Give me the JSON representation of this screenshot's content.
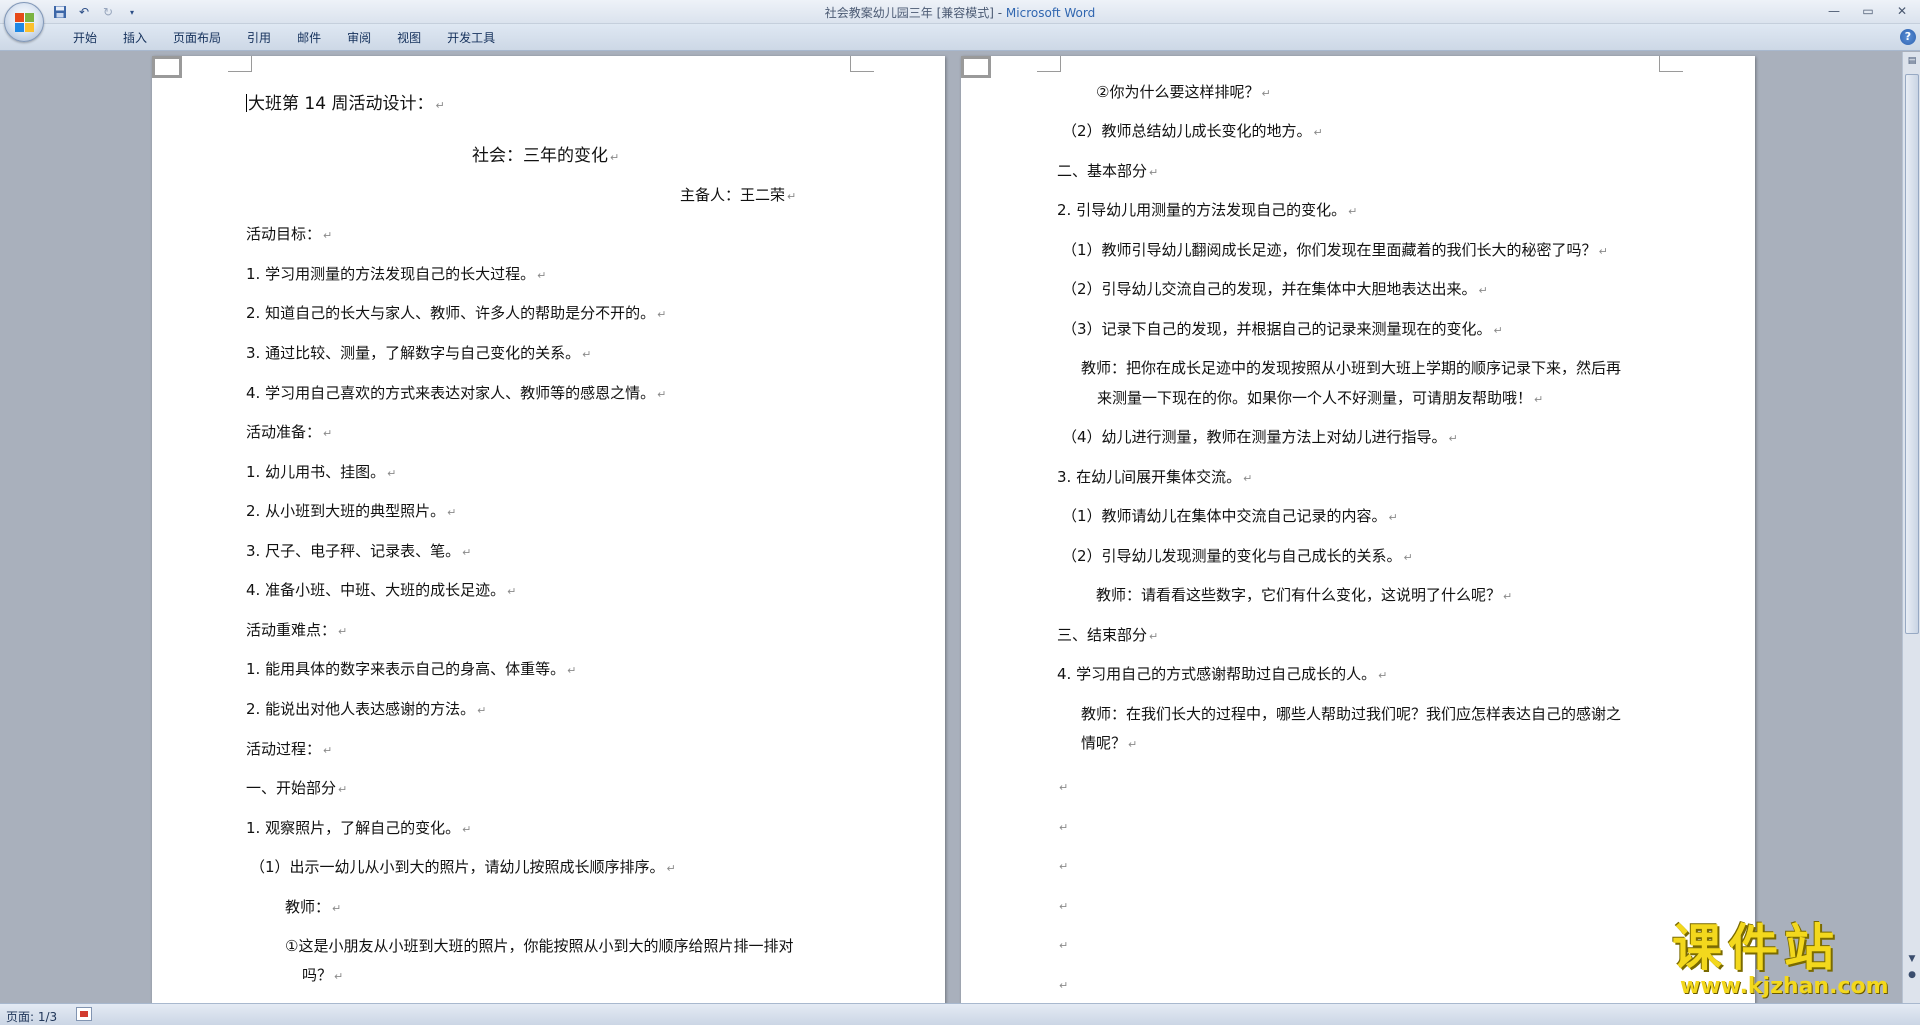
{
  "window": {
    "title_doc": "社会教案幼儿园三年 [兼容模式] - ",
    "title_app": "Microsoft Word"
  },
  "ribbon": {
    "tabs": [
      "开始",
      "插入",
      "页面布局",
      "引用",
      "邮件",
      "审阅",
      "视图",
      "开发工具"
    ]
  },
  "status": {
    "page": "页面: 1/3"
  },
  "watermark": {
    "cn": "课件站",
    "url": "www.kjzhan.com"
  },
  "left_page": {
    "title": "大班第 14 周活动设计：",
    "subtitle": "社会：三年的变化",
    "author": "主备人：王二荣",
    "lines": [
      "活动目标：",
      "1.   学习用测量的方法发现自己的长大过程。",
      "2.   知道自己的长大与家人、教师、许多人的帮助是分不开的。",
      "3.   通过比较、测量，了解数字与自己变化的关系。",
      "4.   学习用自己喜欢的方式来表达对家人、教师等的感恩之情。",
      "活动准备：",
      "1.   幼儿用书、挂图。",
      "2.   从小班到大班的典型照片。",
      "3.   尺子、电子秤、记录表、笔。",
      "4.   准备小班、中班、大班的成长足迹。",
      "活动重难点：",
      "1. 能用具体的数字来表示自己的身高、体重等。",
      "2. 能说出对他人表达感谢的方法。",
      "活动过程：",
      "一、开始部分",
      "1. 观察照片，了解自己的变化。",
      "（1）出示一幼儿从小到大的照片，请幼儿按照成长顺序排序。",
      "教师：",
      "①这是小朋友从小班到大班的照片，你能按照从小到大的顺序给照片排一排对",
      "吗？"
    ]
  },
  "right_page": {
    "lines": [
      "②你为什么要这样排呢？",
      "（2）教师总结幼儿成长变化的地方。",
      "二、基本部分",
      "2. 引导幼儿用测量的方法发现自己的变化。",
      "（1）教师引导幼儿翻阅成长足迹，你们发现在里面藏着的我们长大的秘密了吗？",
      "（2）引导幼儿交流自己的发现，并在集体中大胆地表达出来。",
      "（3）记录下自己的发现，并根据自己的记录来测量现在的变化。",
      "教师：把你在成长足迹中的发现按照从小班到大班上学期的顺序记录下来，然后再",
      "来测量一下现在的你。如果你一个人不好测量，可请朋友帮助哦！",
      "（4）幼儿进行测量，教师在测量方法上对幼儿进行指导。",
      "3. 在幼儿间展开集体交流。",
      "（1）教师请幼儿在集体中交流自己记录的内容。",
      "（2）引导幼儿发现测量的变化与自己成长的关系。",
      "教师：请看看这些数字，它们有什么变化，这说明了什么呢？",
      "三、结束部分",
      "4. 学习用自己的方式感谢帮助过自己成长的人。",
      "教师：在我们长大的过程中，哪些人帮助过我们呢？我们应怎样表达自己的感谢之",
      "情呢？"
    ]
  }
}
